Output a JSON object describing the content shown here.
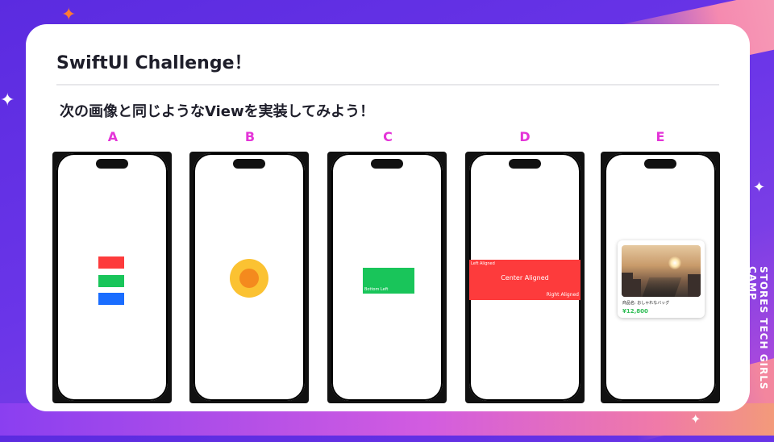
{
  "slide": {
    "title": "SwiftUI Challenge！",
    "subtitle": "次の画像と同じようなViewを実装してみよう！",
    "side_text": "STORES TECH GIRLS CAMP"
  },
  "challenges": [
    {
      "label": "A",
      "colors": [
        "#fd3b3c",
        "#19c55a",
        "#1a6dff"
      ]
    },
    {
      "label": "B",
      "outer_color": "#fbc232",
      "inner_color": "#f48a1e"
    },
    {
      "label": "C",
      "box_color": "#19c55a",
      "box_text": "Bottom Left"
    },
    {
      "label": "D",
      "box_color": "#fd3b3c",
      "top_left": "Left Aligned",
      "center": "Center Aligned",
      "bottom_right": "Right Aligned"
    },
    {
      "label": "E",
      "product_name": "商品名: おしゃれなバッグ",
      "price": "¥12,800",
      "price_color": "#2fbd55"
    }
  ],
  "theme": {
    "label_color": "#e434d8",
    "title_color": "#1e1e2a"
  }
}
